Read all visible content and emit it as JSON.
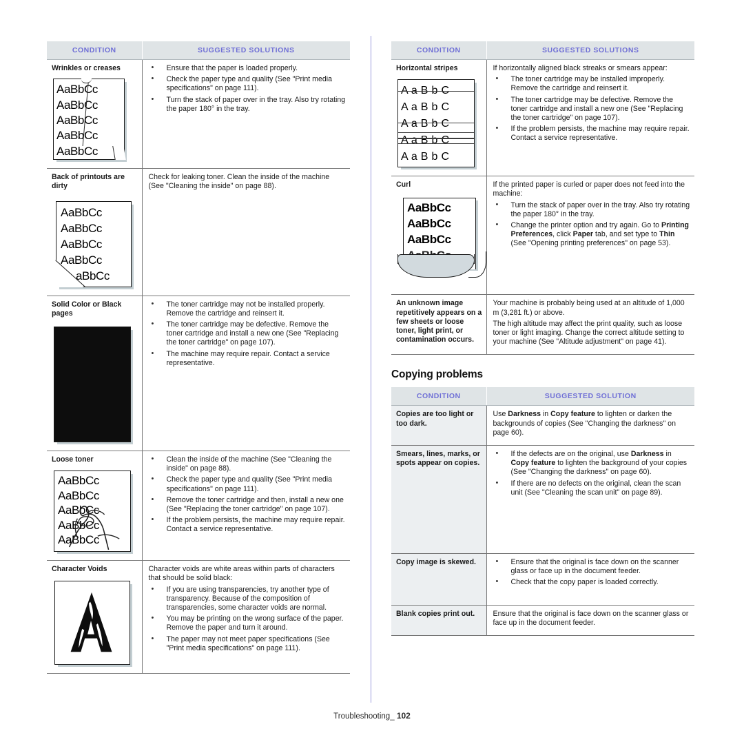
{
  "footer": {
    "label": "Troubleshooting_",
    "page": "102"
  },
  "table_headers": {
    "condition": "CONDITION",
    "solutions": "SUGGESTED SOLUTIONS",
    "solution_singular": "SUGGESTED SOLUTION"
  },
  "colors": {
    "header_bg": "#dfe4e6",
    "header_text": "#6f6fd6",
    "divider": "#9b9bdd",
    "cond_shade": "#eceff1"
  },
  "left_table": {
    "rows": [
      {
        "condition": "Wrinkles or creases",
        "sample": "wrinkled-page-sample",
        "bullets": [
          "Ensure that the paper is loaded properly.",
          "Check the paper type and quality (See \"Print media specifications\" on page 111).",
          "Turn the stack of paper over in the tray. Also try rotating the paper 180° in the tray."
        ]
      },
      {
        "condition": "Back of printouts are dirty",
        "sample": "dirty-back-page-sample",
        "paragraphs": [
          "Check for leaking toner. Clean the inside of the machine (See \"Cleaning the inside\" on page 88)."
        ]
      },
      {
        "condition": "Solid Color or Black pages",
        "sample": "solid-black-page-sample",
        "bullets": [
          "The toner cartridge may not be installed properly. Remove the cartridge and reinsert it.",
          "The toner cartridge may be defective. Remove the toner cartridge and install a new one (See \"Replacing the toner cartridge\" on page 107).",
          "The machine may require repair. Contact a service representative."
        ]
      },
      {
        "condition": "Loose toner",
        "sample": "loose-toner-page-sample",
        "bullets": [
          "Clean the inside of the machine (See \"Cleaning the inside\" on page 88).",
          "Check the paper type and quality (See \"Print media specifications\" on page 111).",
          "Remove the toner cartridge and then, install a new one (See \"Replacing the toner cartridge\" on page 107).",
          "If the problem persists, the machine may require repair. Contact a service representative."
        ]
      },
      {
        "condition": "Character Voids",
        "sample": "character-voids-page-sample",
        "paragraphs": [
          "Character voids are white areas within parts of characters that should be solid black:"
        ],
        "bullets": [
          "If you are using transparencies, try another type of transparency. Because of the composition of transparencies, some character voids are normal.",
          "You may be printing on the wrong surface of the paper. Remove the paper and turn it around.",
          "The paper may not meet paper specifications (See \"Print media specifications\" on page 111)."
        ]
      }
    ]
  },
  "right_table": {
    "rows": [
      {
        "condition": "Horizontal stripes",
        "sample": "horizontal-stripes-page-sample",
        "paragraphs": [
          "If horizontally aligned black streaks or smears appear:"
        ],
        "bullets": [
          "The toner cartridge may be installed improperly. Remove the cartridge and reinsert it.",
          "The toner cartridge may be defective. Remove the toner cartridge and install a new one (See \"Replacing the toner cartridge\" on page 107).",
          "If the problem persists, the machine may require repair. Contact a service representative."
        ]
      },
      {
        "condition": "Curl",
        "sample": "curled-page-sample",
        "paragraphs": [
          "If the printed paper is curled or paper does not feed into the machine:"
        ],
        "bullets_rich": [
          {
            "parts": [
              {
                "t": "Turn the stack of paper over in the tray. Also try rotating the paper 180° in the tray.",
                "b": false
              }
            ]
          },
          {
            "parts": [
              {
                "t": "Change the printer option and try again. Go to ",
                "b": false
              },
              {
                "t": "Printing Preferences",
                "b": true
              },
              {
                "t": ", click ",
                "b": false
              },
              {
                "t": "Paper",
                "b": true
              },
              {
                "t": " tab, and set type to ",
                "b": false
              },
              {
                "t": "Thin",
                "b": true
              },
              {
                "t": " (See \"Opening printing preferences\" on page 53).",
                "b": false
              }
            ]
          }
        ]
      },
      {
        "condition": "An unknown image repetitively appears on a few sheets or loose toner, light print, or contamination occurs.",
        "paragraphs": [
          "Your machine is probably being used at an altitude of 1,000 m (3,281 ft.) or above.",
          "The high altitude may affect the print quality, such as loose toner or light imaging. Change the correct altitude setting to your machine (See \"Altitude adjustment\" on page 41)."
        ]
      }
    ]
  },
  "copying_section": {
    "heading": "Copying problems",
    "rows": [
      {
        "condition": "Copies are too light or too dark.",
        "rich": [
          {
            "parts": [
              {
                "t": "Use ",
                "b": false
              },
              {
                "t": "Darkness",
                "b": true
              },
              {
                "t": " in ",
                "b": false
              },
              {
                "t": "Copy feature",
                "b": true
              },
              {
                "t": " to lighten or darken the backgrounds of copies (See \"Changing the darkness\" on page 60).",
                "b": false
              }
            ]
          }
        ]
      },
      {
        "condition": "Smears, lines, marks, or spots appear on copies.",
        "bullets_rich": [
          {
            "parts": [
              {
                "t": "If the defects are on the original, use ",
                "b": false
              },
              {
                "t": "Darkness",
                "b": true
              },
              {
                "t": " in ",
                "b": false
              },
              {
                "t": "Copy feature",
                "b": true
              },
              {
                "t": " to lighten the background of your copies (See \"Changing the darkness\" on page 60).",
                "b": false
              }
            ]
          },
          {
            "parts": [
              {
                "t": "If there are no defects on the original, clean the scan unit (See \"Cleaning the scan unit\" on page 89).",
                "b": false
              }
            ]
          }
        ]
      },
      {
        "condition": "Copy image is skewed.",
        "bullets": [
          "Ensure that the original is face down on the scanner glass or face up in the document feeder.",
          "Check that the copy paper is loaded correctly."
        ]
      },
      {
        "condition": "Blank copies print out.",
        "paragraphs": [
          "Ensure that the original is face down on the scanner glass or face up in the document feeder."
        ]
      }
    ]
  },
  "samples": {
    "aabbcc": "AaBbCc",
    "wrinkle_lines": [
      "AaBbCc",
      "AaBbCc",
      "AaBbCc",
      "AaBbCc",
      "AaBbCc"
    ],
    "dirty_lines": [
      "AaBbCc",
      "AaBbCc",
      "AaBbCc",
      "AaBbCc",
      "aBbCc"
    ],
    "loose_lines": [
      "AaBbCc",
      "AaBbCc",
      "AaBbCc",
      "AaBbCc",
      "AaBbCc"
    ],
    "stripe_lines": [
      "A a B b C",
      "A a B b C",
      "A a B b C",
      "A a B b C",
      "A a B b C"
    ],
    "curl_lines": [
      "AaBbCc",
      "AaBbCc",
      "AaBbCc",
      "AaBbCc"
    ],
    "void_letter": "A"
  }
}
